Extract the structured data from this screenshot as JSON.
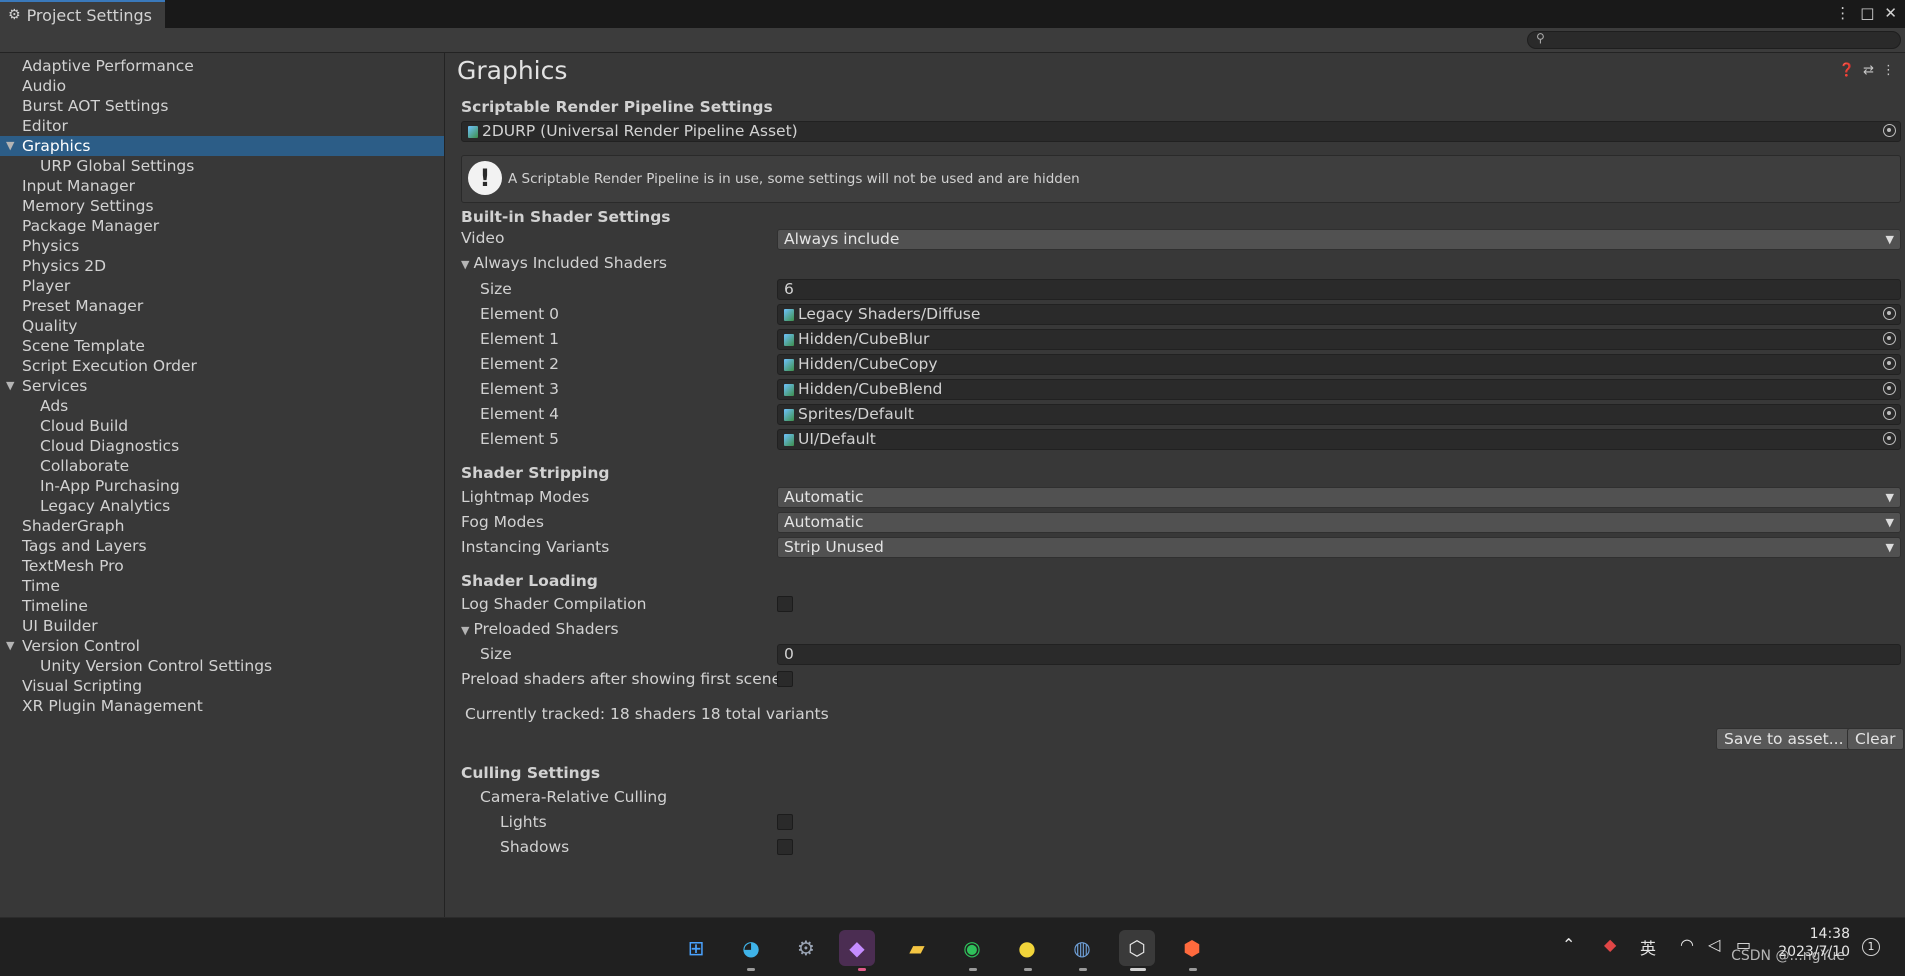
{
  "window": {
    "tab_title": "Project Settings",
    "tab_icon": "gear-icon",
    "controls": [
      "⋮",
      "□",
      "✕"
    ]
  },
  "sidebar": {
    "items": [
      {
        "label": "Adaptive Performance",
        "indent": 0
      },
      {
        "label": "Audio",
        "indent": 0
      },
      {
        "label": "Burst AOT Settings",
        "indent": 0
      },
      {
        "label": "Editor",
        "indent": 0
      },
      {
        "label": "Graphics",
        "indent": 0,
        "selected": true,
        "expanded": true
      },
      {
        "label": "URP Global Settings",
        "indent": 1
      },
      {
        "label": "Input Manager",
        "indent": 0
      },
      {
        "label": "Memory Settings",
        "indent": 0
      },
      {
        "label": "Package Manager",
        "indent": 0
      },
      {
        "label": "Physics",
        "indent": 0
      },
      {
        "label": "Physics 2D",
        "indent": 0
      },
      {
        "label": "Player",
        "indent": 0
      },
      {
        "label": "Preset Manager",
        "indent": 0
      },
      {
        "label": "Quality",
        "indent": 0
      },
      {
        "label": "Scene Template",
        "indent": 0
      },
      {
        "label": "Script Execution Order",
        "indent": 0
      },
      {
        "label": "Services",
        "indent": 0,
        "expanded": true
      },
      {
        "label": "Ads",
        "indent": 1
      },
      {
        "label": "Cloud Build",
        "indent": 1
      },
      {
        "label": "Cloud Diagnostics",
        "indent": 1
      },
      {
        "label": "Collaborate",
        "indent": 1
      },
      {
        "label": "In-App Purchasing",
        "indent": 1
      },
      {
        "label": "Legacy Analytics",
        "indent": 1
      },
      {
        "label": "ShaderGraph",
        "indent": 0
      },
      {
        "label": "Tags and Layers",
        "indent": 0
      },
      {
        "label": "TextMesh Pro",
        "indent": 0
      },
      {
        "label": "Time",
        "indent": 0
      },
      {
        "label": "Timeline",
        "indent": 0
      },
      {
        "label": "UI Builder",
        "indent": 0
      },
      {
        "label": "Version Control",
        "indent": 0,
        "expanded": true
      },
      {
        "label": "Unity Version Control Settings",
        "indent": 1
      },
      {
        "label": "Visual Scripting",
        "indent": 0
      },
      {
        "label": "XR Plugin Management",
        "indent": 0
      }
    ]
  },
  "main": {
    "title": "Graphics",
    "srp": {
      "heading": "Scriptable Render Pipeline Settings",
      "asset": "2DURP (Universal Render Pipeline Asset)",
      "warning": "A Scriptable Render Pipeline is in use, some settings will not be used and are hidden"
    },
    "builtin": {
      "heading": "Built-in Shader Settings",
      "video_label": "Video",
      "video_value": "Always include",
      "always_included_label": "Always Included Shaders",
      "size_label": "Size",
      "size_value": "6",
      "elements": [
        {
          "label": "Element 0",
          "value": "Legacy Shaders/Diffuse"
        },
        {
          "label": "Element 1",
          "value": "Hidden/CubeBlur"
        },
        {
          "label": "Element 2",
          "value": "Hidden/CubeCopy"
        },
        {
          "label": "Element 3",
          "value": "Hidden/CubeBlend"
        },
        {
          "label": "Element 4",
          "value": "Sprites/Default"
        },
        {
          "label": "Element 5",
          "value": "UI/Default"
        }
      ]
    },
    "stripping": {
      "heading": "Shader Stripping",
      "lightmap_label": "Lightmap Modes",
      "lightmap_value": "Automatic",
      "fog_label": "Fog Modes",
      "fog_value": "Automatic",
      "instancing_label": "Instancing Variants",
      "instancing_value": "Strip Unused"
    },
    "loading": {
      "heading": "Shader Loading",
      "log_label": "Log Shader Compilation",
      "preloaded_label": "Preloaded Shaders",
      "size_label": "Size",
      "size_value": "0",
      "preload_after_label": "Preload shaders after showing first scene",
      "tracked": "Currently tracked: 18 shaders 18 total variants",
      "save_button": "Save to asset...",
      "clear_button": "Clear"
    },
    "culling": {
      "heading": "Culling Settings",
      "camera_label": "Camera-Relative Culling",
      "lights_label": "Lights",
      "shadows_label": "Shadows"
    }
  },
  "taskbar": {
    "ime": "英",
    "time": "14:38",
    "date": "2023/7/10",
    "watermark": "CSDN @...ngYue",
    "notification_count": "1"
  },
  "colors": {
    "selection": "#2c5d87",
    "panel": "#383838",
    "field": "#2a2a2a",
    "dropdown": "#515151"
  }
}
